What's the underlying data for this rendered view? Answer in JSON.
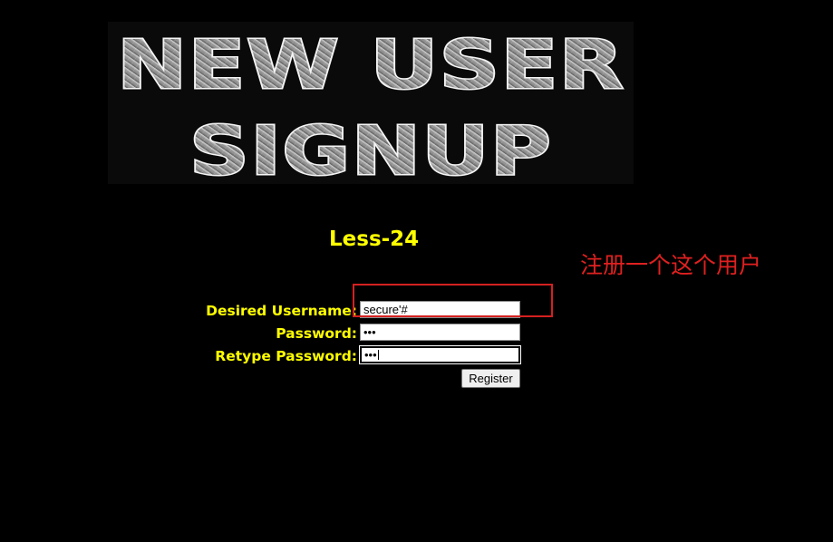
{
  "banner": {
    "line1": "NEW USER",
    "line2": "SIGNUP"
  },
  "lesson_title": "Less-24",
  "form": {
    "username_label": "Desired Username:",
    "password_label": "Password:",
    "retype_label": "Retype Password:",
    "username_value": "secure'#",
    "password_value": "•••",
    "retype_value": "•••",
    "register_label": "Register"
  },
  "annotation": {
    "text": "注册一个这个用户",
    "color": "#e02020"
  },
  "colors": {
    "background": "#000000",
    "label": "#ffff00"
  }
}
